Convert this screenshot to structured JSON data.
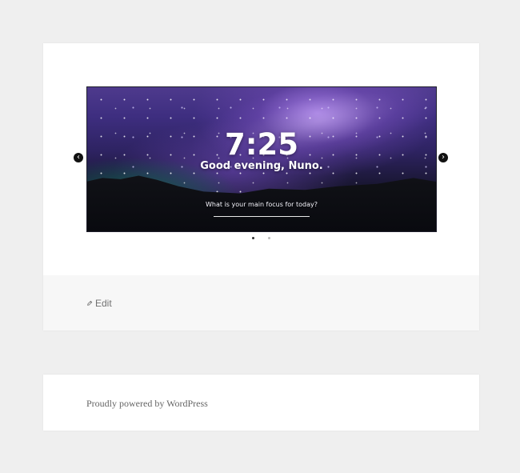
{
  "slider": {
    "time": "7:25",
    "greeting": "Good evening, Nuno.",
    "focus_question": "What is your main focus for today?",
    "previous_arrow": "‹",
    "next_arrow": "›",
    "pagination": [
      {
        "state": "active"
      },
      {
        "state": "inactive"
      }
    ]
  },
  "entry_footer": {
    "edit_label": "Edit",
    "edit_icon": "pencil-icon"
  },
  "site_footer": {
    "powered_by": "Proudly powered by WordPress"
  },
  "colors": {
    "page_background": "#efefef",
    "card_background": "#ffffff",
    "footer_background": "#f7f7f7",
    "text_muted": "#707070",
    "dot_active": "#333333",
    "dot_inactive": "#bbbbbb"
  }
}
